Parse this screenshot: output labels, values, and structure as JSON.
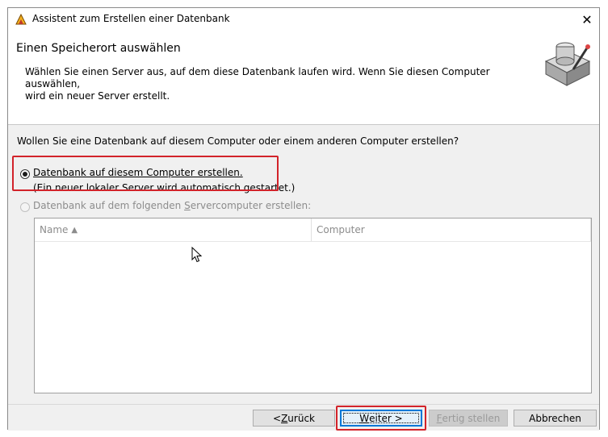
{
  "window": {
    "title": "Assistent zum Erstellen einer Datenbank"
  },
  "header": {
    "title": "Einen Speicherort auswählen",
    "description": "Wählen Sie einen Server aus, auf dem diese Datenbank laufen wird. Wenn Sie diesen Computer auswählen,\nwird ein neuer Server erstellt."
  },
  "content": {
    "question": "Wollen Sie eine Datenbank auf diesem Computer oder einem anderen Computer erstellen?",
    "option_local": {
      "label": "Datenbank auf diesem Computer erstellen.",
      "sublabel": "(Ein neuer lokaler Server wird automatisch gestartet.)",
      "selected": true
    },
    "option_remote": {
      "label_pre": "Datenbank auf dem folgenden ",
      "label_mnemonic": "S",
      "label_post": "ervercomputer erstellen:",
      "selected": false,
      "enabled": false
    },
    "server_list": {
      "columns": [
        "Name",
        "Computer"
      ],
      "sort_indicator": "▲",
      "rows": []
    }
  },
  "footer": {
    "back": {
      "pre": "< ",
      "mnemonic": "Z",
      "post": "urück"
    },
    "next": {
      "mnemonic": "W",
      "post": "eiter >"
    },
    "finish": {
      "mnemonic": "F",
      "post": "ertig stellen"
    },
    "cancel": "Abbrechen"
  },
  "colors": {
    "highlight": "#d2232a",
    "focus": "#0078d7",
    "panel": "#f0f0f0"
  }
}
